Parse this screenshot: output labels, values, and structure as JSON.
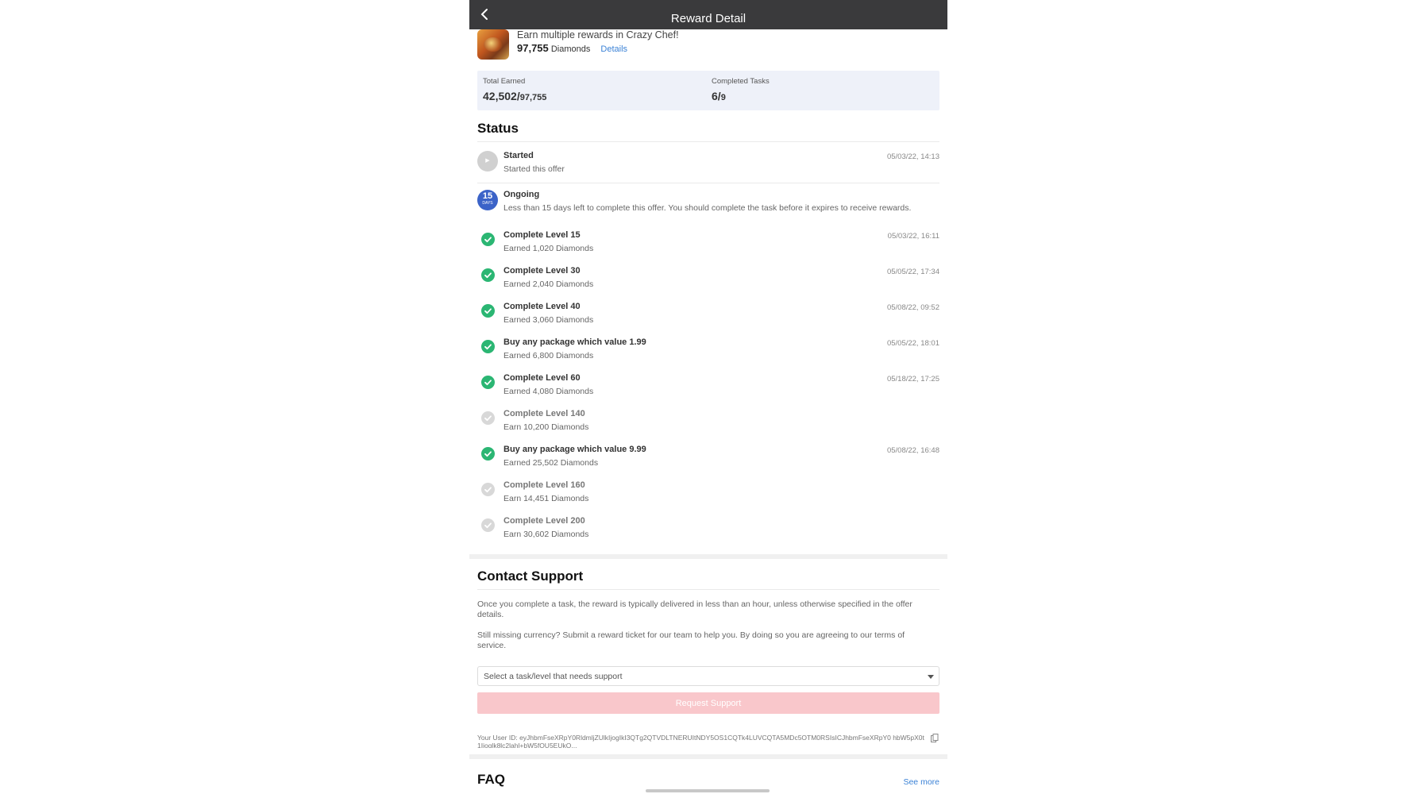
{
  "header": {
    "title": "Reward Detail",
    "back_icon": "chevron-left-icon"
  },
  "offer": {
    "headline": "Earn multiple rewards in Crazy Chef!",
    "amount": "97,755",
    "currency": "Diamonds",
    "details_label": "Details",
    "icon": "crazy-chef-game-icon"
  },
  "summary": {
    "total_label": "Total Earned",
    "total_earned": "42,502/",
    "total_max": "97,755",
    "tasks_label": "Completed Tasks",
    "tasks_done": "6/",
    "tasks_total": "9"
  },
  "status": {
    "heading": "Status",
    "started": {
      "title": "Started",
      "subtitle": "Started this offer",
      "time": "05/03/22, 14:13"
    },
    "ongoing": {
      "title": "Ongoing",
      "days": "15",
      "days_unit": "DAYS",
      "subtitle": "Less than 15 days left to complete this offer. You should complete the task before it expires to receive rewards."
    },
    "tasks": [
      {
        "name": "Complete Level 15",
        "reward": "Earned 1,020 Diamonds",
        "time": "05/03/22, 16:11",
        "done": true
      },
      {
        "name": "Complete Level 30",
        "reward": "Earned 2,040 Diamonds",
        "time": "05/05/22, 17:34",
        "done": true
      },
      {
        "name": "Complete Level 40",
        "reward": "Earned 3,060 Diamonds",
        "time": "05/08/22, 09:52",
        "done": true
      },
      {
        "name": "Buy any package which value 1.99",
        "reward": "Earned 6,800 Diamonds",
        "time": "05/05/22, 18:01",
        "done": true
      },
      {
        "name": "Complete Level 60",
        "reward": "Earned 4,080 Diamonds",
        "time": "05/18/22, 17:25",
        "done": true
      },
      {
        "name": "Complete Level 140",
        "reward": "Earn 10,200 Diamonds",
        "time": "",
        "done": false
      },
      {
        "name": "Buy any package which value 9.99",
        "reward": "Earned 25,502 Diamonds",
        "time": "05/08/22, 16:48",
        "done": true
      },
      {
        "name": "Complete Level 160",
        "reward": "Earn 14,451 Diamonds",
        "time": "",
        "done": false
      },
      {
        "name": "Complete Level 200",
        "reward": "Earn 30,602 Diamonds",
        "time": "",
        "done": false
      }
    ]
  },
  "support": {
    "heading": "Contact Support",
    "para1": "Once you complete a task, the reward is typically delivered in less than an hour, unless otherwise specified in the offer details.",
    "para2": "Still missing currency? Submit a reward ticket for our team to help you. By doing so you are agreeing to our terms of service.",
    "select_placeholder": "Select a task/level that needs support",
    "button_label": "Request Support",
    "user_id": "Your User ID: eyJhbmFseXRpY0RldmljZUlkIjogIkI3QTg2QTVDLTNERUItNDY5OS1CQTk4LUVCQTA5MDc5OTM0RSIsICJhbmFseXRpY0 hbW5pX0t1Ijoglk8lc2lahl+bW5fQU5EUkQ..."
  },
  "faq": {
    "heading": "FAQ",
    "see_more": "See more"
  },
  "colors": {
    "done": "#2bb673",
    "pending": "#d8d8d8",
    "link": "#3b82d6",
    "button_disabled": "#f9c7cb",
    "days_badge": "#3b63c8"
  }
}
